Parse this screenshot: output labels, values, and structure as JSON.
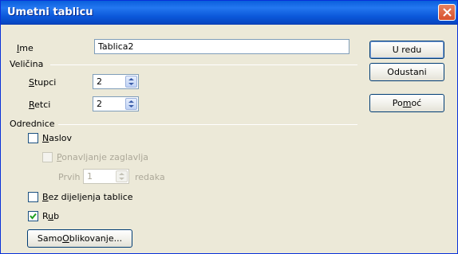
{
  "window": {
    "title": "Umetni tablicu"
  },
  "name_field": {
    "label": "Ime",
    "value": "Tablica2"
  },
  "size_section": {
    "label": "Veličina"
  },
  "columns": {
    "label": "Stupci",
    "value": "2"
  },
  "rows": {
    "label": "Retci",
    "value": "2"
  },
  "options_section": {
    "label": "Odrednice"
  },
  "heading_checkbox": {
    "label": "Naslov",
    "checked": false
  },
  "repeat_heading_checkbox": {
    "label": "Ponavljanje zaglavlja",
    "checked": false,
    "enabled": false
  },
  "first_rows": {
    "prefix": "Prvih",
    "value": "1",
    "suffix": "redaka",
    "enabled": false
  },
  "dont_split_checkbox": {
    "label": "Bez dijeljenja tablice",
    "checked": false
  },
  "border_checkbox": {
    "label": "Rub",
    "checked": true
  },
  "buttons": {
    "autoformat": "SamoOblikovanje...",
    "ok": "U redu",
    "cancel": "Odustani",
    "help": "Pomoć"
  },
  "icons": {
    "close": "close-icon",
    "check": "check-icon",
    "spin": "spin-arrows-icon"
  }
}
